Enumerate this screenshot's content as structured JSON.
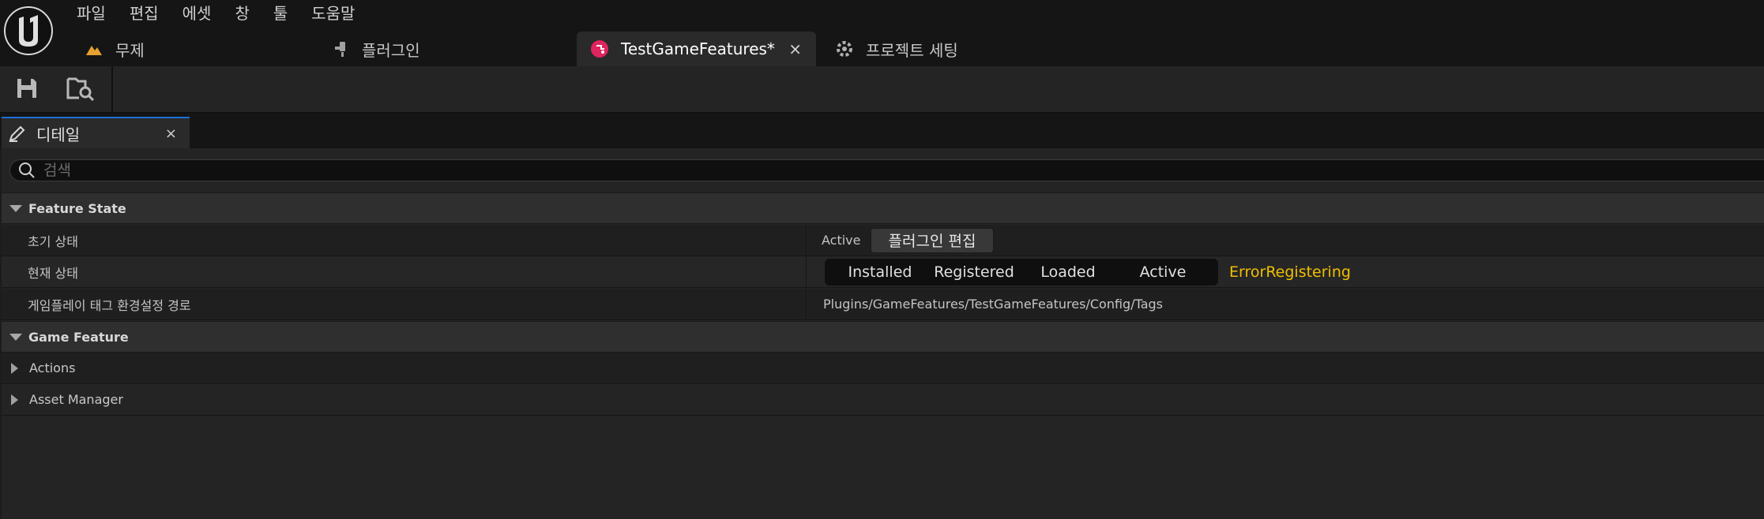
{
  "app": {
    "menu": [
      "파일",
      "편집",
      "에셋",
      "창",
      "툴",
      "도움말"
    ]
  },
  "tabs": [
    {
      "label": "무제",
      "icon": "level-icon"
    },
    {
      "label": "플러그인",
      "icon": "plugin-icon"
    },
    {
      "label": "TestGameFeatures*",
      "icon": "game-feature-icon",
      "active": true,
      "close": "×"
    },
    {
      "label": "프로젝트 세팅",
      "icon": "settings-icon"
    }
  ],
  "toolbar": {
    "save": "save-icon",
    "browse": "browse-asset-icon"
  },
  "panel": {
    "tab_label": "디테일",
    "tab_close": "×"
  },
  "search": {
    "placeholder": "검색"
  },
  "details": {
    "feature_state": {
      "title": "Feature State",
      "initial_state_label": "초기 상태",
      "initial_state_value": "Active",
      "edit_plugin_button": "플러그인 편집",
      "current_state_label": "현재 상태",
      "states": [
        "Installed",
        "Registered",
        "Loaded",
        "Active"
      ],
      "error_state": "ErrorRegistering",
      "tags_path_label": "게임플레이 태그 환경설정 경로",
      "tags_path_value": "Plugins/GameFeatures/TestGameFeatures/Config/Tags"
    },
    "game_feature": {
      "title": "Game Feature",
      "actions": "Actions",
      "asset_manager": "Asset Manager"
    }
  },
  "colors": {
    "error": "#f0c000",
    "accent": "#1a6fd8",
    "game_feature_icon": "#e0245e"
  }
}
